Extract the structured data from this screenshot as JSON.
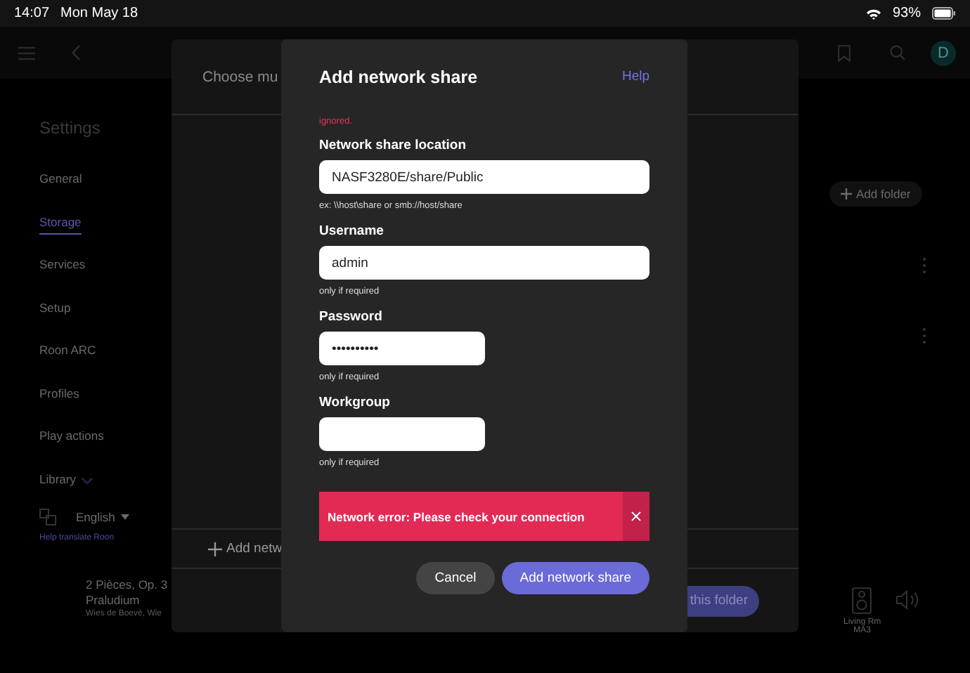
{
  "status_bar": {
    "time": "14:07",
    "date": "Mon May 18",
    "battery": "93%"
  },
  "top_bar": {
    "avatar": "D"
  },
  "sidebar": {
    "title": "Settings",
    "items": [
      {
        "label": "General",
        "selected": false
      },
      {
        "label": "Storage",
        "selected": true
      },
      {
        "label": "Services",
        "selected": false
      },
      {
        "label": "Setup",
        "selected": false
      },
      {
        "label": "Roon ARC",
        "selected": false
      },
      {
        "label": "Profiles",
        "selected": false
      },
      {
        "label": "Play actions",
        "selected": false
      },
      {
        "label": "Library",
        "selected": false
      }
    ],
    "language": "English",
    "help_link": "Help translate Roon"
  },
  "content": {
    "add_folder_button": "Add folder"
  },
  "now_playing": {
    "title": "2 Pièces, Op. 3",
    "subtitle": "Praludium",
    "artists": "Wies de Boevé, Wie",
    "zone": "Living Rm",
    "zone_line_2": "MA3"
  },
  "back_dialog": {
    "title": "Choose mu",
    "add_button": "Add netw",
    "confirm_button": "this folder"
  },
  "dialog": {
    "title": "Add network share",
    "help": "Help",
    "notice": "ignored.",
    "fields": [
      {
        "label": "Network share location",
        "value": "NASF3280E/share/Public",
        "hint": "ex: \\\\host\\share or smb://host/share",
        "wide": true
      },
      {
        "label": "Username",
        "value": "admin",
        "hint": "only if required",
        "wide": true
      },
      {
        "label": "Password",
        "value": "••••••••••",
        "hint": "only if required",
        "wide": false
      },
      {
        "label": "Workgroup",
        "hint": "only if required",
        "wide": false
      }
    ],
    "error": "Network error: Please check your connection",
    "buttons": [
      {
        "label": "Cancel",
        "kind": "secondary"
      },
      {
        "label": "Add network share",
        "kind": "primary"
      }
    ]
  }
}
